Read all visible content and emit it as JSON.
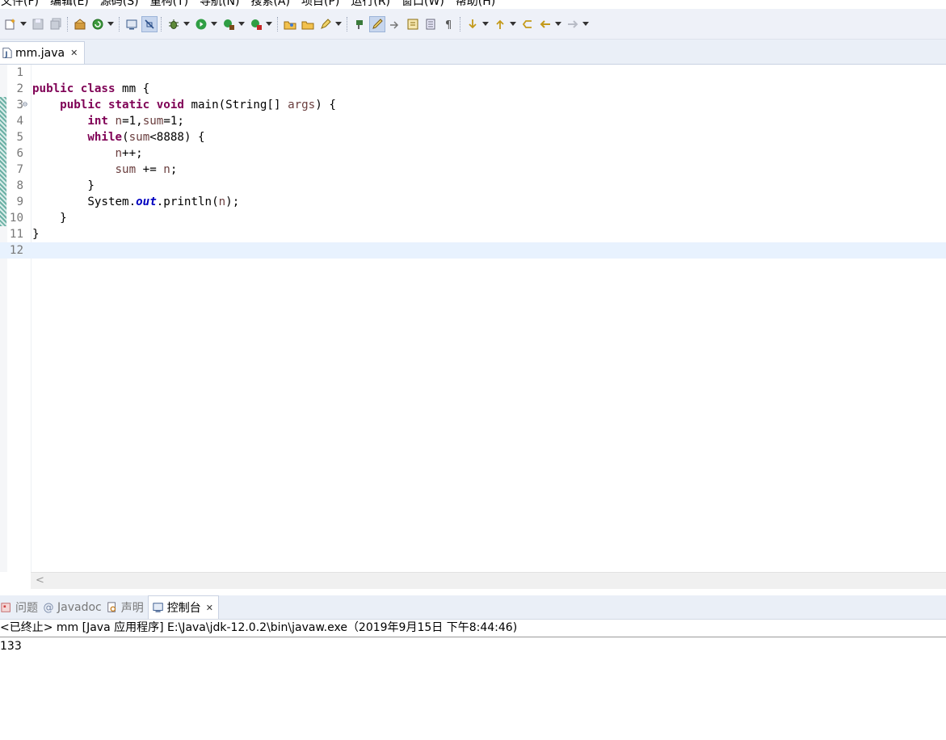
{
  "menubar": {
    "items": [
      "文件(F)",
      "编辑(E)",
      "源码(S)",
      "重构(T)",
      "导航(N)",
      "搜索(A)",
      "项目(P)",
      "运行(R)",
      "窗口(W)",
      "帮助(H)"
    ]
  },
  "toolbar": {
    "icons": [
      "new-icon",
      "save-icon",
      "save-all-icon",
      "package-icon",
      "refresh-icon",
      "console-icon",
      "toggle-mark-icon",
      "debug-icon",
      "run-icon",
      "coverage-icon",
      "external-tools-icon",
      "open-type-icon",
      "open-folder-icon",
      "pencil-icon",
      "next-annotation-icon",
      "highlight-icon",
      "link-icon",
      "toggle-block-icon",
      "word-wrap-icon",
      "pilcrow-icon",
      "next-edit-icon",
      "prev-edit-icon",
      "last-edit-icon",
      "back-icon",
      "forward-icon"
    ]
  },
  "editor": {
    "tab": {
      "label": "mm.java",
      "close": "✕"
    },
    "lines": [
      {
        "n": "1",
        "tokens": []
      },
      {
        "n": "2",
        "tokens": [
          [
            "kw",
            "public"
          ],
          [
            "t",
            " "
          ],
          [
            "kw",
            "class"
          ],
          [
            "t",
            " mm {"
          ]
        ]
      },
      {
        "n": "3",
        "fold": "⊖",
        "tokens": [
          [
            "t",
            "    "
          ],
          [
            "kw",
            "public"
          ],
          [
            "t",
            " "
          ],
          [
            "kw",
            "static"
          ],
          [
            "t",
            " "
          ],
          [
            "kw",
            "void"
          ],
          [
            "t",
            " main(String[] "
          ],
          [
            "var",
            "args"
          ],
          [
            "t",
            ") {"
          ]
        ]
      },
      {
        "n": "4",
        "tokens": [
          [
            "t",
            "        "
          ],
          [
            "kw",
            "int"
          ],
          [
            "t",
            " "
          ],
          [
            "var",
            "n"
          ],
          [
            "t",
            "=1,"
          ],
          [
            "var",
            "sum"
          ],
          [
            "t",
            "=1;"
          ]
        ]
      },
      {
        "n": "5",
        "tokens": [
          [
            "t",
            "        "
          ],
          [
            "kw",
            "while"
          ],
          [
            "t",
            "("
          ],
          [
            "var",
            "sum"
          ],
          [
            "t",
            "<8888) {"
          ]
        ]
      },
      {
        "n": "6",
        "tokens": [
          [
            "t",
            "            "
          ],
          [
            "var",
            "n"
          ],
          [
            "t",
            "++;"
          ]
        ]
      },
      {
        "n": "7",
        "tokens": [
          [
            "t",
            "            "
          ],
          [
            "var",
            "sum"
          ],
          [
            "t",
            " += "
          ],
          [
            "var",
            "n"
          ],
          [
            "t",
            ";"
          ]
        ]
      },
      {
        "n": "8",
        "tokens": [
          [
            "t",
            "        }"
          ]
        ]
      },
      {
        "n": "9",
        "tokens": [
          [
            "t",
            "        System."
          ],
          [
            "fld",
            "out"
          ],
          [
            "t",
            ".println("
          ],
          [
            "var",
            "n"
          ],
          [
            "t",
            ");"
          ]
        ]
      },
      {
        "n": "10",
        "tokens": [
          [
            "t",
            "    }"
          ]
        ]
      },
      {
        "n": "11",
        "tokens": [
          [
            "t",
            "}"
          ]
        ]
      },
      {
        "n": "12",
        "tokens": [],
        "current": true
      }
    ],
    "scroll_left": "<"
  },
  "views": {
    "tabs": [
      {
        "label": "问题",
        "icon": "problems-icon"
      },
      {
        "label": "Javadoc",
        "icon": "at-icon"
      },
      {
        "label": "声明",
        "icon": "declaration-icon"
      },
      {
        "label": "控制台",
        "icon": "console-icon",
        "active": true,
        "close": "✕"
      }
    ]
  },
  "console": {
    "header": "<已终止> mm [Java 应用程序] E:\\Java\\jdk-12.0.2\\bin\\javaw.exe（2019年9月15日 下午8:44:46)",
    "output": "133"
  },
  "colors": {
    "keyword": "#7f0055",
    "variable": "#6a3e3e",
    "field": "#0000c0",
    "current_line": "#e8f2fe",
    "toolbar_bg": "#eef1f8"
  }
}
